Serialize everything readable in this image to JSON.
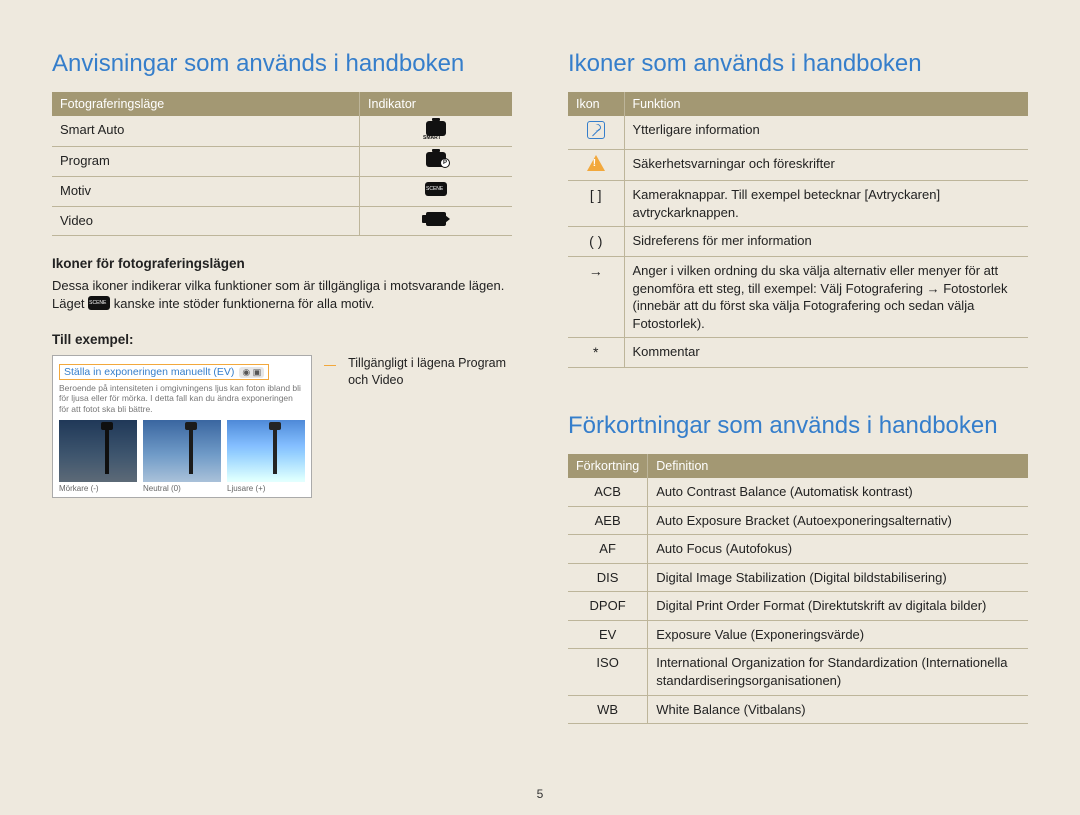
{
  "page_number": "5",
  "left": {
    "title": "Anvisningar som används i handboken",
    "modes_table": {
      "headers": [
        "Fotograferingsläge",
        "Indikator"
      ],
      "rows": [
        {
          "label": "Smart Auto",
          "icon": "smart-auto-icon"
        },
        {
          "label": "Program",
          "icon": "program-icon"
        },
        {
          "label": "Motiv",
          "icon": "scene-icon"
        },
        {
          "label": "Video",
          "icon": "video-icon"
        }
      ]
    },
    "sub1_title": "Ikoner för fotograferingslägen",
    "sub1_para_a": "Dessa ikoner indikerar vilka funktioner som är tillgängliga i motsvarande lägen. Läget ",
    "sub1_para_b": " kanske inte stöder funktionerna för alla motiv.",
    "sub2_title": "Till exempel:",
    "example": {
      "box_title": "Ställa in exponeringen manuellt (EV)",
      "box_desc": "Beroende på intensiteten i omgivningens ljus kan foton ibland bli för ljusa eller för mörka. I detta fall kan du ändra exponeringen för att fotot ska bli bättre.",
      "thumbs": [
        {
          "cap": "Mörkare (-)"
        },
        {
          "cap": "Neutral (0)"
        },
        {
          "cap": "Ljusare (+)"
        }
      ],
      "side_text": "Tillgängligt i lägena Program och Video"
    }
  },
  "right": {
    "title1": "Ikoner som används i handboken",
    "icons_table": {
      "headers": [
        "Ikon",
        "Funktion"
      ],
      "rows": [
        {
          "icon": "note",
          "text": "Ytterligare information"
        },
        {
          "icon": "warn",
          "text": "Säkerhetsvarningar och föreskrifter"
        },
        {
          "icon": "[ ]",
          "text_a": "Kameraknappar. Till exempel betecknar [",
          "bold_a": "Avtryckaren",
          "text_b": "] avtryckarknappen."
        },
        {
          "icon": "( )",
          "text": "Sidreferens för mer information"
        },
        {
          "icon": "→",
          "text_a": "Anger i vilken ordning du ska välja alternativ eller menyer för att genomföra ett steg, till exempel: Välj ",
          "bold_a": "Fotografering",
          "arrow": " → ",
          "bold_b": "Fotostorlek",
          "text_b": " (innebär att du först ska välja ",
          "bold_c": "Fotografering",
          "text_c": " och sedan välja ",
          "bold_d": "Fotostorlek",
          "text_d": ")."
        },
        {
          "icon": "*",
          "text": "Kommentar"
        }
      ]
    },
    "title2": "Förkortningar som används i handboken",
    "abbr_table": {
      "headers": [
        "Förkortning",
        "Definition"
      ],
      "rows": [
        {
          "abbr": "ACB",
          "def": "Auto Contrast Balance (Automatisk kontrast)"
        },
        {
          "abbr": "AEB",
          "def": "Auto Exposure Bracket (Autoexponeringsalternativ)"
        },
        {
          "abbr": "AF",
          "def": "Auto Focus (Autofokus)"
        },
        {
          "abbr": "DIS",
          "def": "Digital Image Stabilization (Digital bildstabilisering)"
        },
        {
          "abbr": "DPOF",
          "def": "Digital Print Order Format (Direktutskrift av digitala bilder)"
        },
        {
          "abbr": "EV",
          "def": "Exposure Value (Exponeringsvärde)"
        },
        {
          "abbr": "ISO",
          "def": "International Organization for Standardization (Internationella standardiseringsorganisationen)"
        },
        {
          "abbr": "WB",
          "def": "White Balance (Vitbalans)"
        }
      ]
    }
  }
}
